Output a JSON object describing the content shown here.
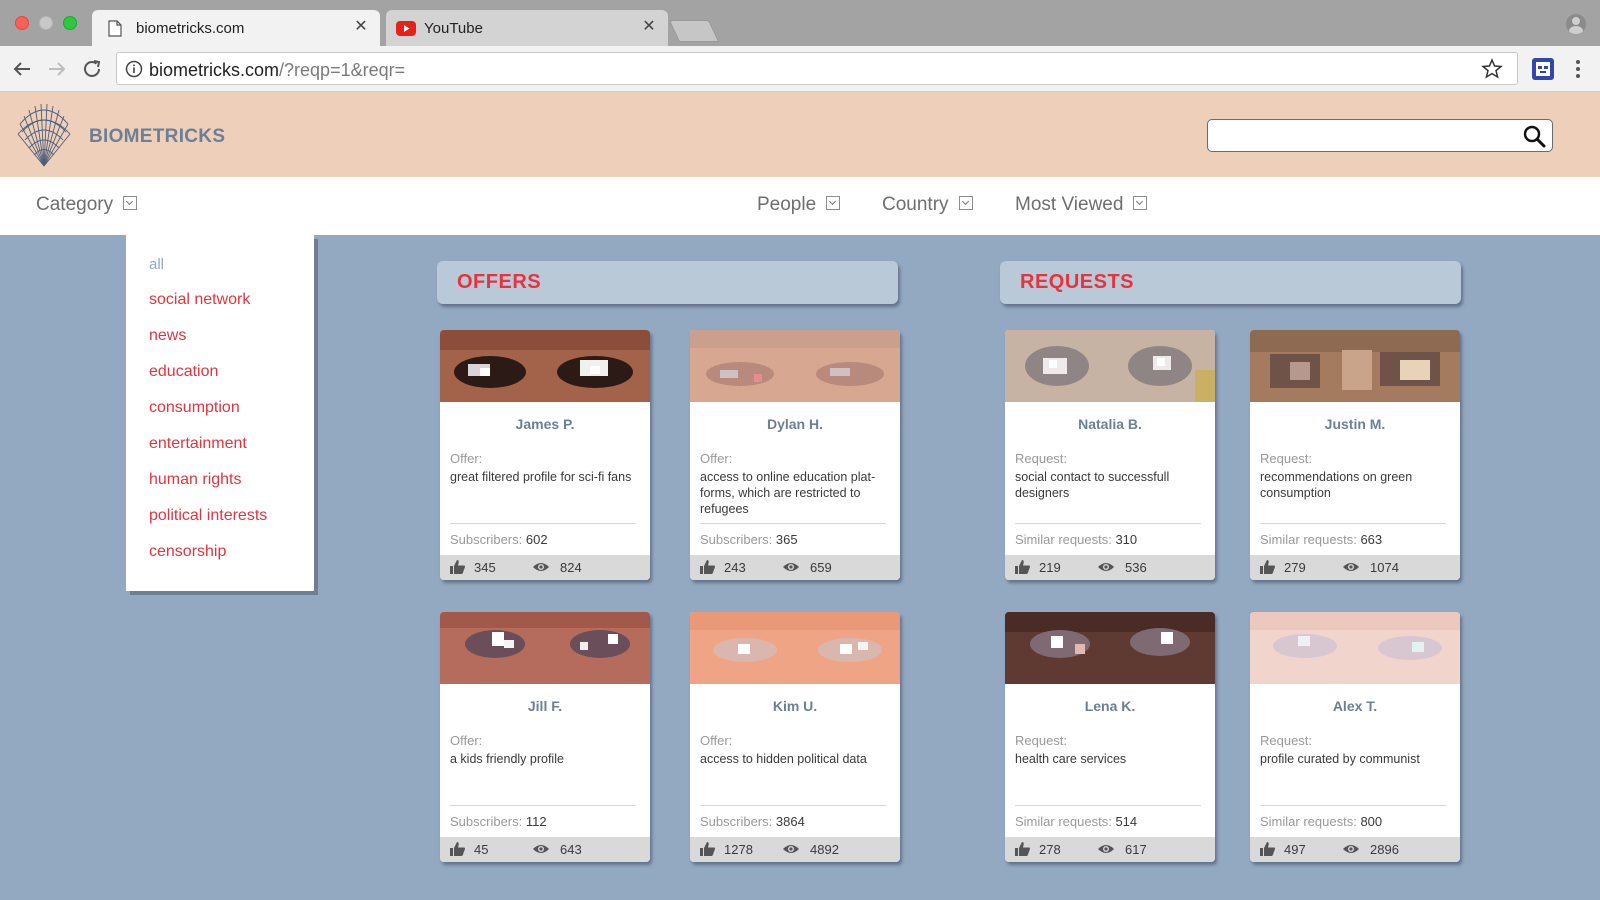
{
  "browser": {
    "tabs": [
      {
        "title": "biometricks.com",
        "icon": "document-icon",
        "active": true
      },
      {
        "title": "YouTube",
        "icon": "youtube-icon",
        "active": false
      }
    ],
    "url_host": "biometricks.com",
    "url_rest": "/?reqp=1&reqr="
  },
  "site": {
    "brand": "BIOMETRICKS",
    "search_placeholder": ""
  },
  "filters": {
    "category": "Category",
    "people": "People",
    "country": "Country",
    "most_viewed": "Most Viewed"
  },
  "category_menu": [
    "all",
    "social network",
    "news",
    "education",
    "consumption",
    "entertainment",
    "human rights",
    "political interests",
    "censorship"
  ],
  "sections": {
    "offers": "OFFERS",
    "requests": "REQUESTS"
  },
  "offers": [
    {
      "name": "James P.",
      "kind": "Offer:",
      "desc": "great filtered profile for sci-fi fans",
      "stat_label": "Subscribers:",
      "stat": "602",
      "likes": "345",
      "views": "824"
    },
    {
      "name": "Dylan H.",
      "kind": "Offer:",
      "desc": "access to online education plat-forms, which are restricted to refugees",
      "stat_label": "Subscribers:",
      "stat": "365",
      "likes": "243",
      "views": "659"
    },
    {
      "name": "Jill F.",
      "kind": "Offer:",
      "desc": "a kids friendly profile",
      "stat_label": "Subscribers:",
      "stat": "112",
      "likes": "45",
      "views": "643"
    },
    {
      "name": "Kim U.",
      "kind": "Offer:",
      "desc": "access to hidden political data",
      "stat_label": "Subscribers:",
      "stat": "3864",
      "likes": "1278",
      "views": "4892"
    }
  ],
  "requests": [
    {
      "name": "Natalia B.",
      "kind": "Request:",
      "desc": "social contact to successfull designers",
      "stat_label": "Similar requests:",
      "stat": "310",
      "likes": "219",
      "views": "536"
    },
    {
      "name": "Justin M.",
      "kind": "Request:",
      "desc": "recommendations on green consumption",
      "stat_label": "Similar requests:",
      "stat": "663",
      "likes": "279",
      "views": "1074"
    },
    {
      "name": "Lena K.",
      "kind": "Request:",
      "desc": "health care services",
      "stat_label": "Similar requests:",
      "stat": "514",
      "likes": "278",
      "views": "617"
    },
    {
      "name": "Alex T.",
      "kind": "Request:",
      "desc": "profile curated by communist",
      "stat_label": "Similar requests:",
      "stat": "800",
      "likes": "497",
      "views": "2896"
    }
  ],
  "colors": {
    "accent_red": "#e8323c",
    "header_bg": "#eecfb9",
    "page_bg": "#93a9c2",
    "brand_text": "#6d7f96"
  }
}
